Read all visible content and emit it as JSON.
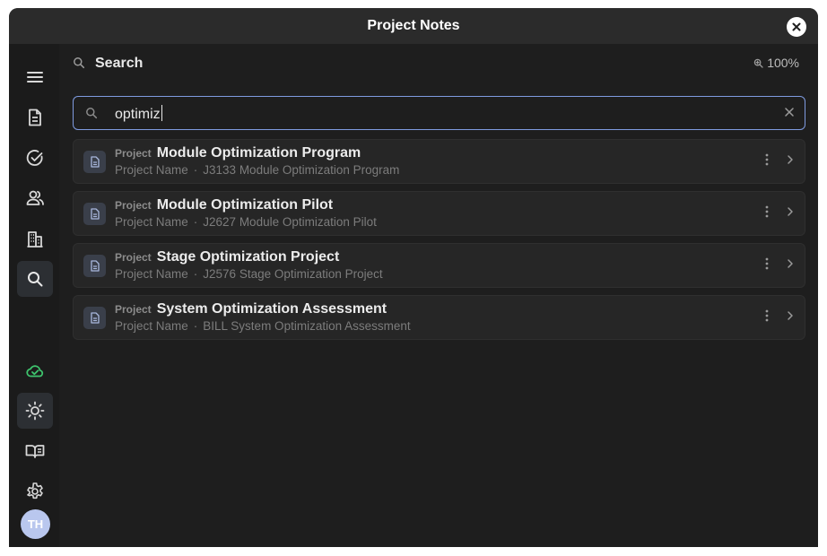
{
  "window": {
    "title": "Project Notes"
  },
  "user": {
    "initials": "TH"
  },
  "header": {
    "title": "Search",
    "zoom": "100%"
  },
  "search": {
    "query": "optimiz"
  },
  "results": [
    {
      "type": "Project",
      "title": "Module Optimization Program",
      "field": "Project Name",
      "detail": "J3133 Module Optimization Program"
    },
    {
      "type": "Project",
      "title": "Module Optimization Pilot",
      "field": "Project Name",
      "detail": "J2627 Module Optimization Pilot"
    },
    {
      "type": "Project",
      "title": "Stage Optimization Project",
      "field": "Project Name",
      "detail": "J2576 Stage Optimization Project"
    },
    {
      "type": "Project",
      "title": "System Optimization Assessment",
      "field": "Project Name",
      "detail": "BILL System Optimization Assessment"
    }
  ],
  "colors": {
    "sync_ok": "#3ec46d",
    "focus_border": "#7f9be0",
    "avatar": "#b9c7ee"
  }
}
